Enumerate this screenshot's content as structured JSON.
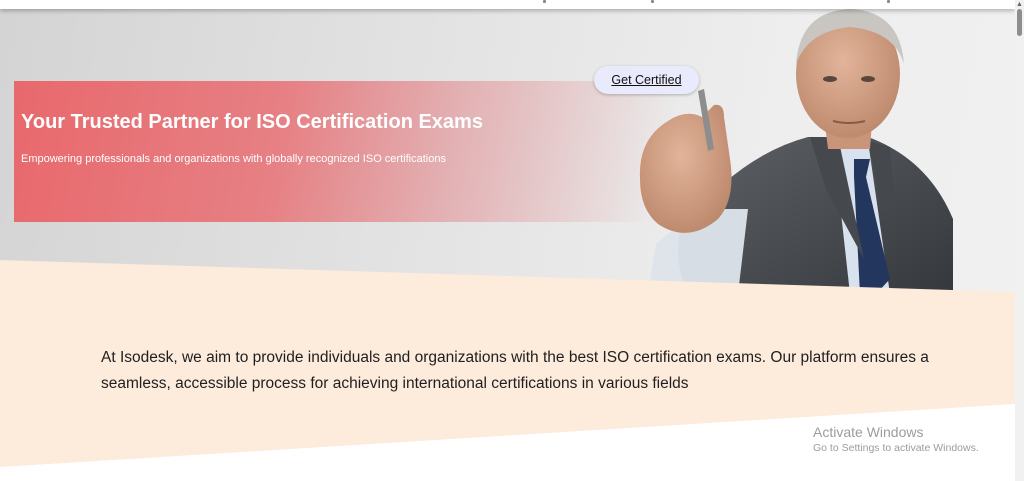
{
  "hero": {
    "title": "Your Trusted Partner for ISO Certification Exams",
    "subtitle": "Empowering professionals and organizations with globally recognized ISO certifications",
    "cta_label": "Get Certified"
  },
  "about": {
    "text": "At Isodesk, we aim to provide individuals and organizations with the best ISO certification exams. Our platform ensures a seamless, accessible process for achieving international certifications in various fields"
  },
  "watermark": {
    "line1": "Activate Windows",
    "line2": "Go to Settings to activate Windows."
  },
  "colors": {
    "banner_red": "#e96468",
    "peach_band": "#fdebdc",
    "cta_background": "#e9eafb"
  },
  "icons": {
    "scroll_up": "scroll-up-arrow-icon"
  }
}
